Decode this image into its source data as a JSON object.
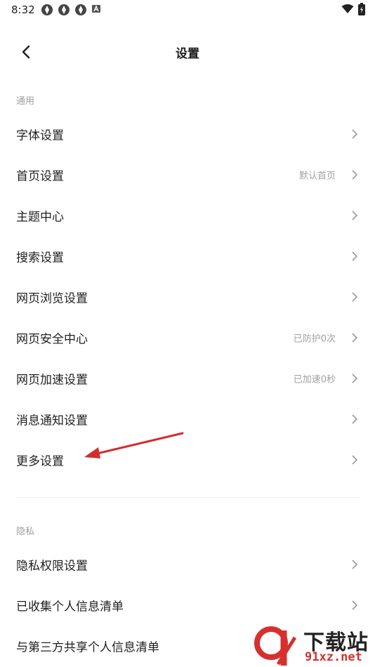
{
  "status_bar": {
    "time": "8:32"
  },
  "header": {
    "title": "设置"
  },
  "sections": {
    "general_label": "通用",
    "privacy_label": "隐私"
  },
  "general_items": [
    {
      "label": "字体设置",
      "value": ""
    },
    {
      "label": "首页设置",
      "value": "默认首页"
    },
    {
      "label": "主题中心",
      "value": ""
    },
    {
      "label": "搜索设置",
      "value": ""
    },
    {
      "label": "网页浏览设置",
      "value": ""
    },
    {
      "label": "网页安全中心",
      "value": "已防护0次"
    },
    {
      "label": "网页加速设置",
      "value": "已加速0秒"
    },
    {
      "label": "消息通知设置",
      "value": ""
    },
    {
      "label": "更多设置",
      "value": ""
    }
  ],
  "privacy_items": [
    {
      "label": "隐私权限设置",
      "value": ""
    },
    {
      "label": "已收集个人信息清单",
      "value": ""
    },
    {
      "label": "与第三方共享个人信息清单",
      "value": ""
    }
  ],
  "watermark": {
    "top_text": "下载站",
    "bottom_text": "91xz.net"
  },
  "colors": {
    "accent_arrow": "#d62b2b",
    "secondary_text": "#a0a0a0"
  },
  "icons": [
    "back-arrow-icon",
    "chevron-right-icon",
    "wifi-icon",
    "battery-icon"
  ]
}
